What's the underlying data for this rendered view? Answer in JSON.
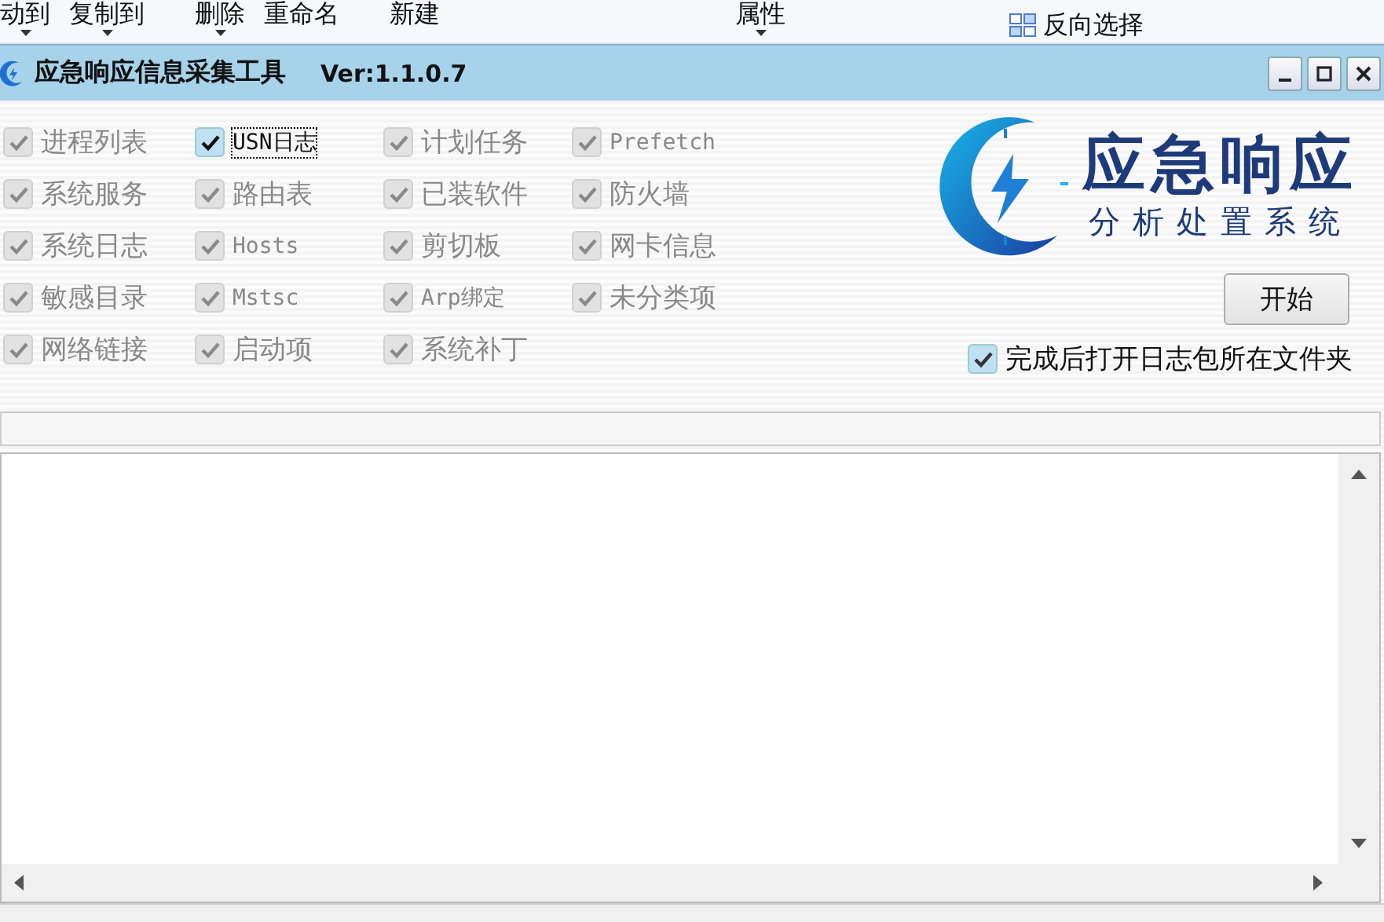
{
  "ribbon": {
    "items": [
      {
        "label": "动到",
        "caret": true
      },
      {
        "label": "复制到",
        "caret": true
      },
      {
        "label": "删除",
        "caret": true
      },
      {
        "label": "重命名",
        "caret": false
      },
      {
        "label": "新建",
        "caret": false
      },
      {
        "label": "属性",
        "caret": true
      },
      {
        "label": "反向选择",
        "caret": false
      }
    ]
  },
  "window": {
    "title": "应急响应信息采集工具",
    "version": "Ver:1.1.0.7"
  },
  "options": [
    {
      "label": "进程列表",
      "checked": true,
      "disabled": true,
      "focused": false
    },
    {
      "label": "USN日志",
      "checked": true,
      "disabled": false,
      "focused": true
    },
    {
      "label": "计划任务",
      "checked": true,
      "disabled": true,
      "focused": false
    },
    {
      "label": "Prefetch",
      "checked": true,
      "disabled": true,
      "focused": false
    },
    {
      "label": "系统服务",
      "checked": true,
      "disabled": true,
      "focused": false
    },
    {
      "label": "路由表",
      "checked": true,
      "disabled": true,
      "focused": false
    },
    {
      "label": "已装软件",
      "checked": true,
      "disabled": true,
      "focused": false
    },
    {
      "label": "防火墙",
      "checked": true,
      "disabled": true,
      "focused": false
    },
    {
      "label": "系统日志",
      "checked": true,
      "disabled": true,
      "focused": false
    },
    {
      "label": "Hosts",
      "checked": true,
      "disabled": true,
      "focused": false
    },
    {
      "label": "剪切板",
      "checked": true,
      "disabled": true,
      "focused": false
    },
    {
      "label": "网卡信息",
      "checked": true,
      "disabled": true,
      "focused": false
    },
    {
      "label": "敏感目录",
      "checked": true,
      "disabled": true,
      "focused": false
    },
    {
      "label": "Mstsc",
      "checked": true,
      "disabled": true,
      "focused": false
    },
    {
      "label": "Arp绑定",
      "checked": true,
      "disabled": true,
      "focused": false
    },
    {
      "label": "未分类项",
      "checked": true,
      "disabled": true,
      "focused": false
    },
    {
      "label": "网络链接",
      "checked": true,
      "disabled": true,
      "focused": false
    },
    {
      "label": "启动项",
      "checked": true,
      "disabled": true,
      "focused": false
    },
    {
      "label": "系统补丁",
      "checked": true,
      "disabled": true,
      "focused": false
    }
  ],
  "logo": {
    "title": "应急响应",
    "subtitle": "分析处置系统"
  },
  "start_button": "开始",
  "open_folder": {
    "label": "完成后打开日志包所在文件夹",
    "checked": true
  }
}
